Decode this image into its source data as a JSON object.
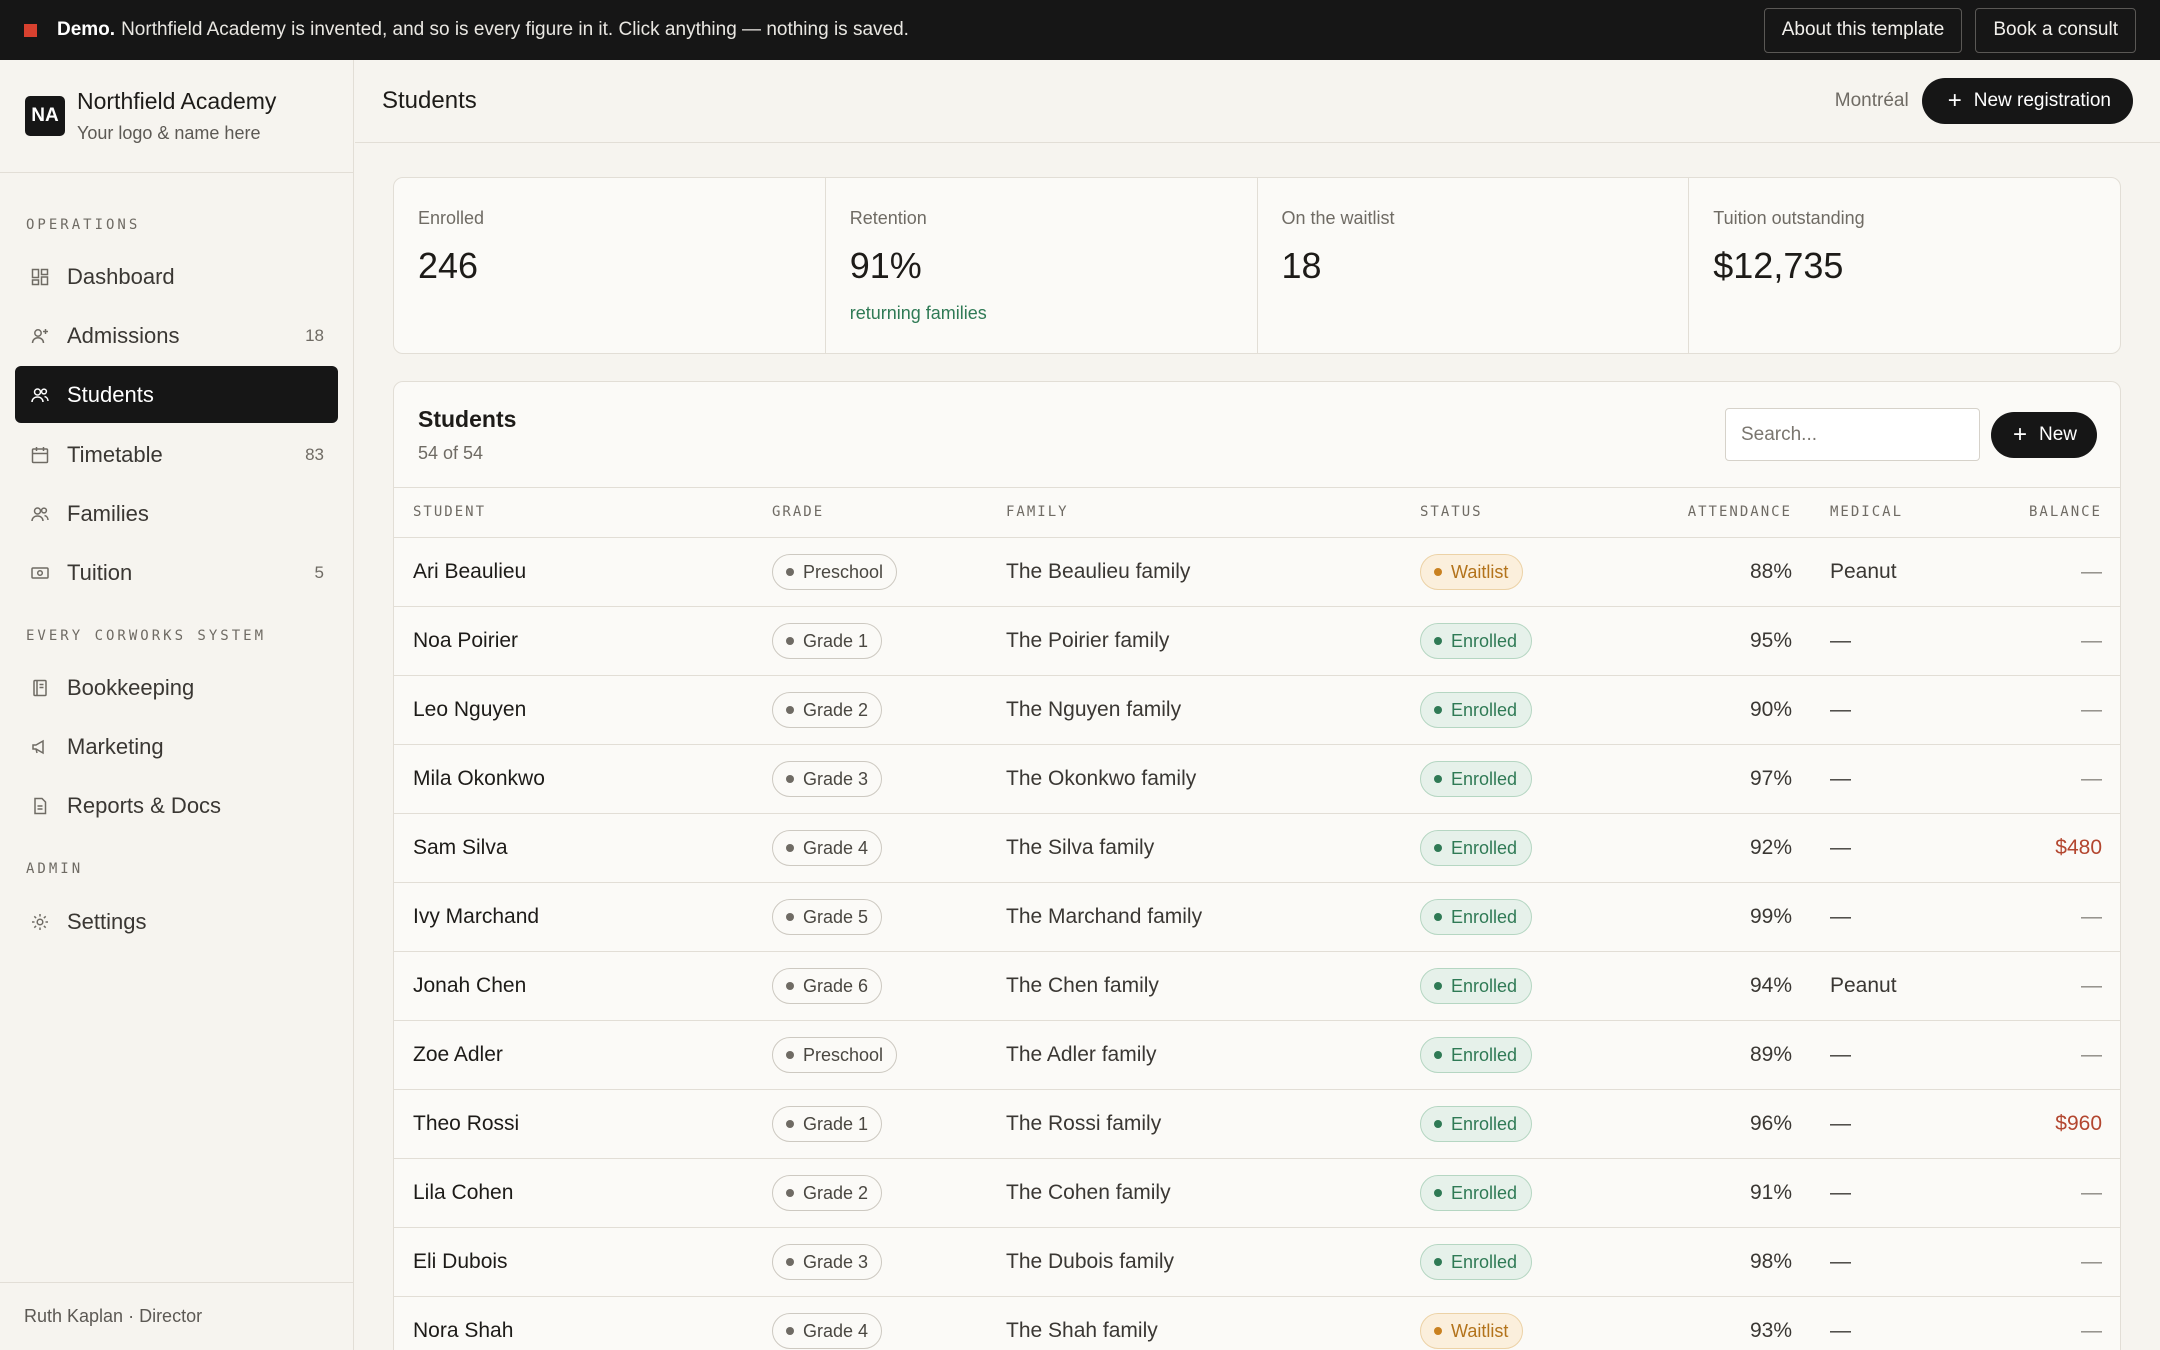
{
  "banner": {
    "label": "Demo.",
    "text": "Northfield Academy is invented, and so is every figure in it. Click anything — nothing is saved.",
    "about_label": "About this template",
    "consult_label": "Book a consult"
  },
  "brand": {
    "initials": "NA",
    "name": "Northfield Academy",
    "subtitle": "Your logo & name here"
  },
  "sidebar": {
    "sections": [
      "OPERATIONS",
      "EVERY CORWORKS SYSTEM",
      "ADMIN"
    ],
    "items": [
      {
        "label": "Dashboard",
        "icon": "dashboard-icon",
        "count": ""
      },
      {
        "label": "Admissions",
        "icon": "admissions-icon",
        "count": "18"
      },
      {
        "label": "Students",
        "icon": "students-icon",
        "count": ""
      },
      {
        "label": "Timetable",
        "icon": "calendar-icon",
        "count": "83"
      },
      {
        "label": "Families",
        "icon": "families-icon",
        "count": ""
      },
      {
        "label": "Tuition",
        "icon": "money-icon",
        "count": "5"
      },
      {
        "label": "Bookkeeping",
        "icon": "book-icon",
        "count": ""
      },
      {
        "label": "Marketing",
        "icon": "megaphone-icon",
        "count": ""
      },
      {
        "label": "Reports & Docs",
        "icon": "document-icon",
        "count": ""
      },
      {
        "label": "Settings",
        "icon": "gear-icon",
        "count": ""
      }
    ],
    "active": "Students",
    "footer": "Ruth Kaplan · Director"
  },
  "header": {
    "title": "Students",
    "city": "Montréal",
    "new_registration_label": "New registration"
  },
  "stats": [
    {
      "label": "Enrolled",
      "value": "246",
      "note": ""
    },
    {
      "label": "Retention",
      "value": "91%",
      "note": "returning families"
    },
    {
      "label": "On the waitlist",
      "value": "18",
      "note": ""
    },
    {
      "label": "Tuition outstanding",
      "value": "$12,735",
      "note": ""
    }
  ],
  "table": {
    "title": "Students",
    "subtitle": "54 of 54",
    "search_placeholder": "Search...",
    "new_label": "New",
    "columns": [
      "STUDENT",
      "GRADE",
      "FAMILY",
      "STATUS",
      "ATTENDANCE",
      "MEDICAL",
      "BALANCE"
    ],
    "rows": [
      {
        "student": "Ari Beaulieu",
        "grade": "Preschool",
        "family": "The Beaulieu family",
        "status": "Waitlist",
        "attendance": "88%",
        "medical": "Peanut",
        "balance": "—"
      },
      {
        "student": "Noa Poirier",
        "grade": "Grade 1",
        "family": "The Poirier family",
        "status": "Enrolled",
        "attendance": "95%",
        "medical": "—",
        "balance": "—"
      },
      {
        "student": "Leo Nguyen",
        "grade": "Grade 2",
        "family": "The Nguyen family",
        "status": "Enrolled",
        "attendance": "90%",
        "medical": "—",
        "balance": "—"
      },
      {
        "student": "Mila Okonkwo",
        "grade": "Grade 3",
        "family": "The Okonkwo family",
        "status": "Enrolled",
        "attendance": "97%",
        "medical": "—",
        "balance": "—"
      },
      {
        "student": "Sam Silva",
        "grade": "Grade 4",
        "family": "The Silva family",
        "status": "Enrolled",
        "attendance": "92%",
        "medical": "—",
        "balance": "$480"
      },
      {
        "student": "Ivy Marchand",
        "grade": "Grade 5",
        "family": "The Marchand family",
        "status": "Enrolled",
        "attendance": "99%",
        "medical": "—",
        "balance": "—"
      },
      {
        "student": "Jonah Chen",
        "grade": "Grade 6",
        "family": "The Chen family",
        "status": "Enrolled",
        "attendance": "94%",
        "medical": "Peanut",
        "balance": "—"
      },
      {
        "student": "Zoe Adler",
        "grade": "Preschool",
        "family": "The Adler family",
        "status": "Enrolled",
        "attendance": "89%",
        "medical": "—",
        "balance": "—"
      },
      {
        "student": "Theo Rossi",
        "grade": "Grade 1",
        "family": "The Rossi family",
        "status": "Enrolled",
        "attendance": "96%",
        "medical": "—",
        "balance": "$960"
      },
      {
        "student": "Lila Cohen",
        "grade": "Grade 2",
        "family": "The Cohen family",
        "status": "Enrolled",
        "attendance": "91%",
        "medical": "—",
        "balance": "—"
      },
      {
        "student": "Eli Dubois",
        "grade": "Grade 3",
        "family": "The Dubois family",
        "status": "Enrolled",
        "attendance": "98%",
        "medical": "—",
        "balance": "—"
      },
      {
        "student": "Nora Shah",
        "grade": "Grade 4",
        "family": "The Shah family",
        "status": "Waitlist",
        "attendance": "93%",
        "medical": "—",
        "balance": "—"
      }
    ]
  },
  "colors": {
    "dark": "#161616",
    "enrolled": "#2f7a55",
    "waitlist": "#b3731b",
    "balance_due": "#b3462f",
    "banner_square": "#d8412f"
  }
}
